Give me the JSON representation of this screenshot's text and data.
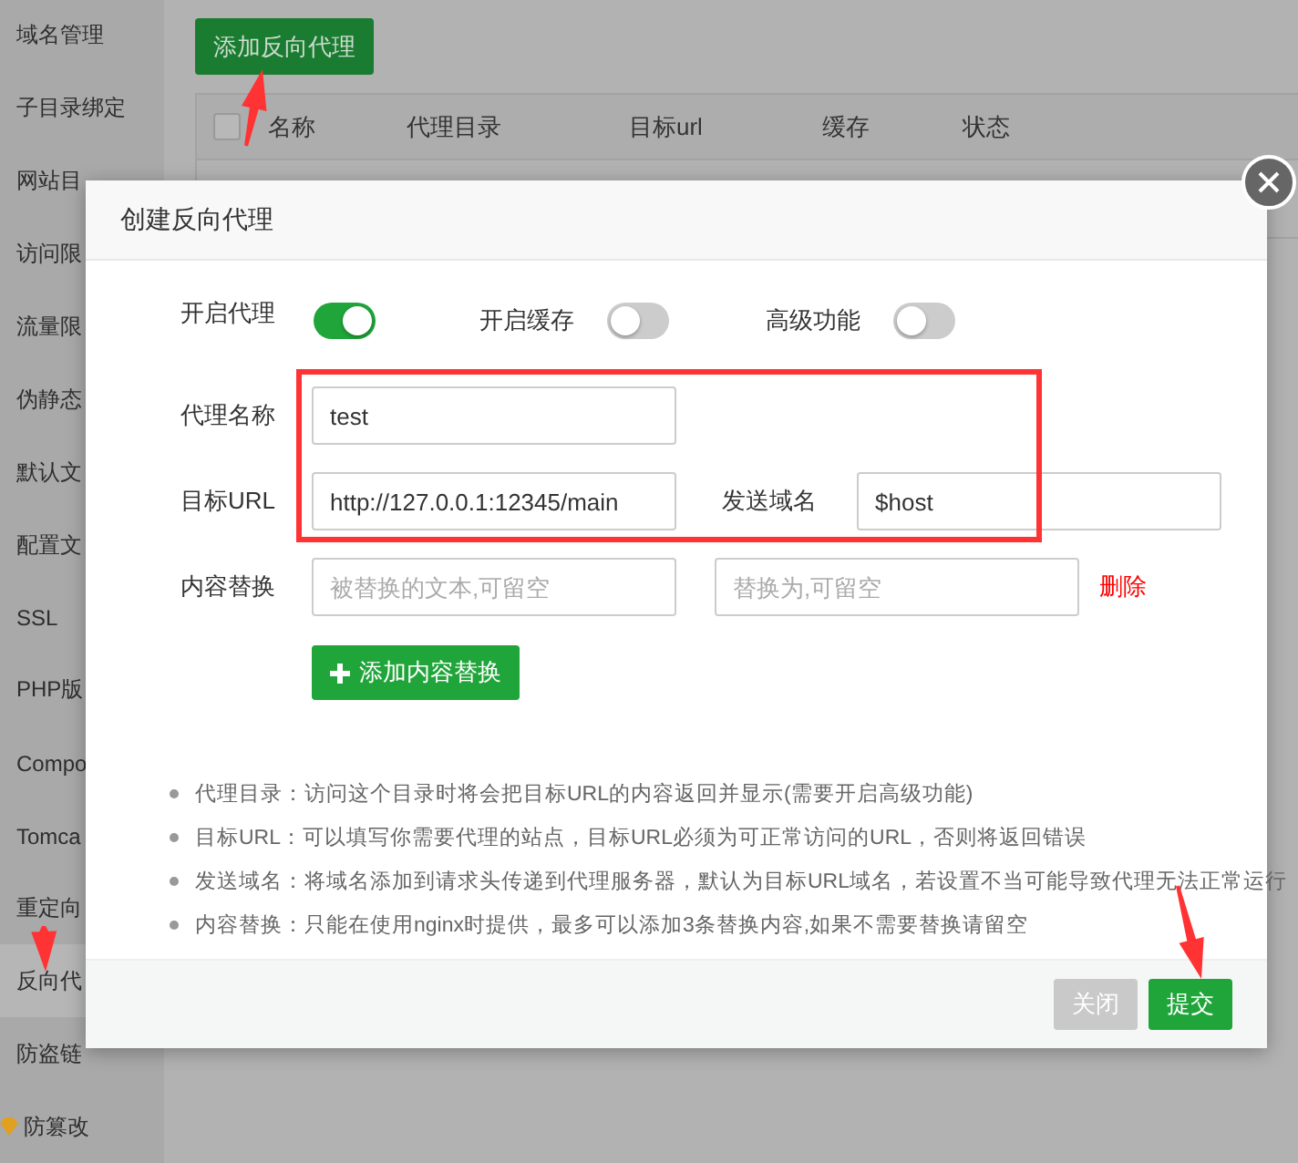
{
  "background_page": {
    "sidebar": {
      "items": [
        {
          "label": "域名管理",
          "selected": false
        },
        {
          "label": "子目录绑定",
          "selected": false
        },
        {
          "label": "网站目",
          "selected": false
        },
        {
          "label": "访问限",
          "selected": false
        },
        {
          "label": "流量限",
          "selected": false
        },
        {
          "label": "伪静态",
          "selected": false
        },
        {
          "label": "默认文",
          "selected": false
        },
        {
          "label": "配置文",
          "selected": false
        },
        {
          "label": "SSL",
          "selected": false
        },
        {
          "label": "PHP版",
          "selected": false
        },
        {
          "label": "Compo",
          "selected": false
        },
        {
          "label": "Tomca",
          "selected": false
        },
        {
          "label": "重定向",
          "selected": false
        },
        {
          "label": "反向代",
          "selected": true
        },
        {
          "label": "防盗链",
          "selected": false
        },
        {
          "label": "防篡改",
          "selected": false,
          "kind": "premium"
        }
      ]
    },
    "add_button": "添加反向代理",
    "table": {
      "select_all_checked": false,
      "columns": [
        "名称",
        "代理目录",
        "目标url",
        "缓存",
        "状态"
      ]
    }
  },
  "dialog": {
    "title": "创建反向代理",
    "switches": [
      {
        "label": "开启代理",
        "on": true
      },
      {
        "label": "开启缓存",
        "on": false
      },
      {
        "label": "高级功能",
        "on": false
      }
    ],
    "name_field": {
      "label": "代理名称",
      "value": "test"
    },
    "url_field": {
      "label": "目标URL",
      "value": "http://127.0.0.1:12345/main"
    },
    "host_field": {
      "label": "发送域名",
      "value": "$host"
    },
    "replace_row": {
      "label": "内容替换",
      "from_placeholder": "被替换的文本,可留空",
      "to_placeholder": "替换为,可留空",
      "delete_link": "删除"
    },
    "add_replace_button": "添加内容替换",
    "notes": [
      "代理目录：访问这个目录时将会把目标URL的内容返回并显示(需要开启高级功能)",
      "目标URL：可以填写你需要代理的站点，目标URL必须为可正常访问的URL，否则将返回错误",
      "发送域名：将域名添加到请求头传递到代理服务器，默认为目标URL域名，若设置不当可能导致代理无法正常运行",
      "内容替换：只能在使用nginx时提供，最多可以添加3条替换内容,如果不需要替换请留空"
    ],
    "buttons": [
      {
        "label": "关闭",
        "kind": "secondary"
      },
      {
        "label": "提交",
        "kind": "primary"
      }
    ]
  }
}
